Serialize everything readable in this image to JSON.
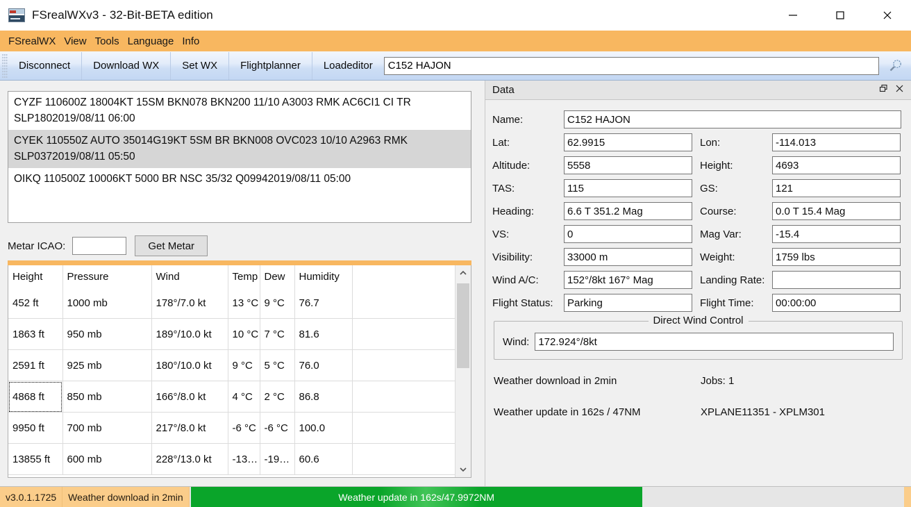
{
  "window": {
    "title": "FSrealWXv3 - 32-Bit-BETA edition",
    "icon": "app-logo-icon",
    "minimize": "minimize-icon",
    "maximize": "maximize-icon",
    "close": "close-icon"
  },
  "menubar": {
    "items": [
      {
        "label": "FSrealWX"
      },
      {
        "label": "View"
      },
      {
        "label": "Tools"
      },
      {
        "label": "Language"
      },
      {
        "label": "Info"
      }
    ]
  },
  "toolbar": {
    "buttons": [
      {
        "label": "Disconnect"
      },
      {
        "label": "Download WX"
      },
      {
        "label": "Set WX"
      },
      {
        "label": "Flightplanner"
      },
      {
        "label": "Loadeditor"
      }
    ],
    "aircraft_value": "C152 HAJON",
    "aircraft_placeholder": "",
    "search_icon": "magnifier-icon"
  },
  "metar": {
    "rows": [
      {
        "text": "CYZF 110600Z 18004KT 15SM BKN078 BKN200 11/10 A3003 RMK AC6CI1 CI TR SLP1802019/08/11 06:00",
        "selected": false
      },
      {
        "text": "CYEK 110550Z AUTO 35014G19KT 5SM BR BKN008 OVC023 10/10 A2963 RMK SLP0372019/08/11 05:50",
        "selected": true
      },
      {
        "text": "OIKQ 110500Z 10006KT 5000 BR NSC 35/32 Q09942019/08/11 05:00",
        "selected": false
      }
    ],
    "icao_label": "Metar ICAO:",
    "icao_value": "",
    "icao_placeholder": "",
    "get_button": "Get Metar"
  },
  "wx_table": {
    "headers": [
      "Height",
      "Pressure",
      "Wind",
      "Temp",
      "Dew",
      "Humidity"
    ],
    "rows": [
      [
        "452 ft",
        "1000 mb",
        "178°/7.0 kt",
        "13 °C",
        "9 °C",
        "76.7"
      ],
      [
        "1863 ft",
        "950 mb",
        "189°/10.0 kt",
        "10 °C",
        "7 °C",
        "81.6"
      ],
      [
        "2591 ft",
        "925 mb",
        "180°/10.0 kt",
        "9 °C",
        "5 °C",
        "76.0"
      ],
      [
        "4868 ft",
        "850 mb",
        "166°/8.0 kt",
        "4 °C",
        "2 °C",
        "86.8"
      ],
      [
        "9950 ft",
        "700 mb",
        "217°/8.0 kt",
        "-6 °C",
        "-6 °C",
        "100.0"
      ],
      [
        "13855 ft",
        "600 mb",
        "228°/13.0 kt",
        "-13…",
        "-19…",
        "60.6"
      ]
    ],
    "focused_row": 3,
    "focused_col": 0,
    "scroll_up_icon": "chevron-up-icon",
    "scroll_down_icon": "chevron-down-icon"
  },
  "data_panel": {
    "title": "Data",
    "float_icon": "restore-window-icon",
    "close_icon": "close-icon",
    "fields": {
      "name_label": "Name:",
      "name_value": "C152 HAJON",
      "lat_label": "Lat:",
      "lat_value": "62.9915",
      "lon_label": "Lon:",
      "lon_value": "-114.013",
      "altitude_label": "Altitude:",
      "altitude_value": "5558",
      "height_label": "Height:",
      "height_value": "4693",
      "tas_label": "TAS:",
      "tas_value": "115",
      "gs_label": "GS:",
      "gs_value": "121",
      "heading_label": "Heading:",
      "heading_value": "6.6 T 351.2 Mag",
      "course_label": "Course:",
      "course_value": "0.0 T 15.4 Mag",
      "vs_label": "VS:",
      "vs_value": "0",
      "magvar_label": "Mag Var:",
      "magvar_value": "-15.4",
      "visibility_label": "Visibility:",
      "visibility_value": "33000 m",
      "weight_label": "Weight:",
      "weight_value": "1759 lbs",
      "windac_label": "Wind A/C:",
      "windac_value": "152°/8kt  167° Mag",
      "landingrate_label": "Landing Rate:",
      "landingrate_value": "",
      "flightstatus_label": "Flight Status:",
      "flightstatus_value": "Parking",
      "flighttime_label": "Flight Time:",
      "flighttime_value": "00:00:00"
    },
    "direct_wind": {
      "legend": "Direct Wind Control",
      "wind_label": "Wind:",
      "wind_value": "172.924°/8kt"
    },
    "status": {
      "download": "Weather download in 2min",
      "jobs": "Jobs: 1",
      "update": "Weather update in 162s / 47NM",
      "sim": "XPLANE11351 - XPLM301"
    }
  },
  "statusbar": {
    "version": "v3.0.1.1725",
    "download": "Weather download in 2min",
    "progress_text": "Weather update in 162s/47.9972NM",
    "progress_color": "#0aa52a",
    "cell_color": "#fbcd8a"
  }
}
